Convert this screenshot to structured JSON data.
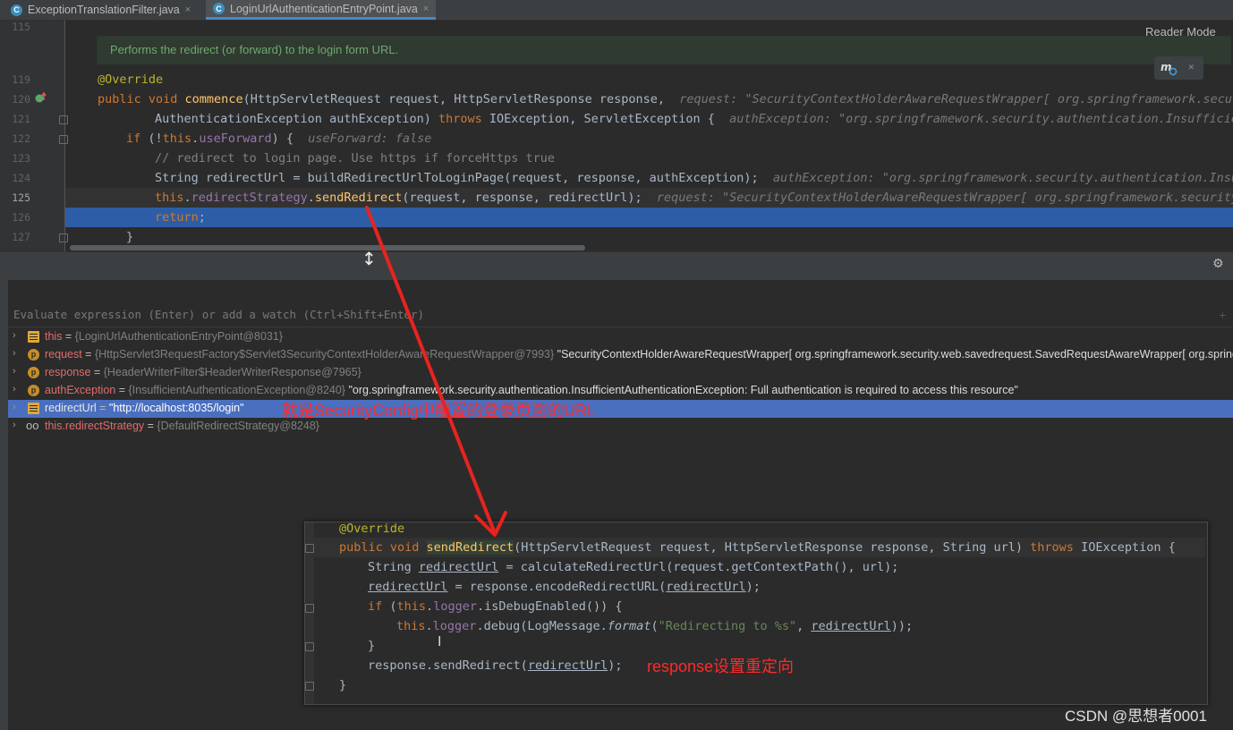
{
  "tabs": [
    {
      "label": "ExceptionTranslationFilter.java",
      "icon": "class-icon",
      "close": "×"
    },
    {
      "label": "LoginUrlAuthenticationEntryPoint.java",
      "icon": "class-icon",
      "close": "×"
    }
  ],
  "editor": {
    "reader_mode": "Reader Mode",
    "doc_comment": "Performs the redirect (or forward) to the login form URL.",
    "line_numbers": [
      "115",
      "119",
      "120",
      "121",
      "122",
      "123",
      "124",
      "125",
      "126",
      "127"
    ],
    "lines": {
      "l119": {
        "annotation": "@Override"
      },
      "l120": {
        "kw": "public void ",
        "fn": "commence",
        "rest": "(HttpServletRequest request, HttpServletResponse response, ",
        "hint": "request: \"SecurityContextHolderAwareRequestWrapper[ org.springframework.security.web.savedrequest.SavedRequestAwareWrapper"
      },
      "l121": {
        "text": "AuthenticationException authException) ",
        "kw": "throws",
        "rest": " IOException, ServletException {",
        "hint": "authException: \"org.springframework.security.authentication.InsufficientAuthenticationException"
      },
      "l122": {
        "kw": "if ",
        "pre": "(!",
        "kw2": "this",
        "dot": ".",
        "fld": "useForward",
        "post": ") {",
        "hint": "useForward: false"
      },
      "l123": {
        "comment": "// redirect to login page. Use https if forceHttps true"
      },
      "l124": {
        "text": "String redirectUrl = buildRedirectUrlToLoginPage(request, response, authException);",
        "hint": "authException: \"org.springframework.security.authentication.InsufficientAuthenticationException"
      },
      "l125": {
        "kw": "this",
        "dot": ".",
        "fld": "redirectStrategy",
        "dot2": ".",
        "call": "sendRedirect",
        "rest": "(request, response, redirectUrl);",
        "hint": "request: \"SecurityContextHolderAwareRequestWrapper[ org.springframework.security.web.savedrequest.SavedRequestAwareWrapper"
      },
      "l126": {
        "kw": "return",
        "rest": ";"
      },
      "l127": {
        "text": "}"
      }
    }
  },
  "debugger": {
    "evaluate_placeholder": "Evaluate expression (Enter) or add a watch (Ctrl+Shift+Enter)",
    "add_icon": "+",
    "variables": [
      {
        "name": "this",
        "eq": " = ",
        "type": "{LoginUrlAuthenticationEntryPoint@8031}",
        "value": "",
        "icon": "field-icon"
      },
      {
        "name": "request",
        "eq": " = ",
        "type": "{HttpServlet3RequestFactory$Servlet3SecurityContextHolderAwareRequestWrapper@7993}",
        "value": " \"SecurityContextHolderAwareRequestWrapper[ org.springframework.security.web.savedrequest.SavedRequestAwareWrapper[ org.springframework.security.web.firewall.FirewalledRequest]]\"",
        "icon": "param-icon"
      },
      {
        "name": "response",
        "eq": " = ",
        "type": "{HeaderWriterFilter$HeaderWriterResponse@7965}",
        "value": "",
        "icon": "param-icon"
      },
      {
        "name": "authException",
        "eq": " = ",
        "type": "{InsufficientAuthenticationException@8240}",
        "value": " \"org.springframework.security.authentication.InsufficientAuthenticationException: Full authentication is required to access this resource\"",
        "icon": "param-icon"
      },
      {
        "name": "redirectUrl",
        "eq": " = ",
        "type": "",
        "value": "\"http://localhost:8035/login\"",
        "icon": "field-icon"
      },
      {
        "name": "this.redirectStrategy",
        "eq": " = ",
        "type": "{DefaultRedirectStrategy@8248}",
        "value": "",
        "icon": "watch-icon"
      }
    ]
  },
  "annotations": {
    "redirect_note": "就是SecurityConfig中配置的登录页面的URL",
    "response_note": "response设置重定向"
  },
  "popup": {
    "l1": "@Override",
    "l2": {
      "kw": "public void ",
      "fn": "sendRedirect",
      "a": "(HttpServletRequest request, HttpServletResponse response, String url) ",
      "kw2": "throws",
      "b": " IOException {"
    },
    "l3": {
      "a": "String ",
      "u": "redirectUrl",
      "b": " = calculateRedirectUrl(request.getContextPath(), url);"
    },
    "l4": {
      "u": "redirectUrl",
      "b": " = response.encodeRedirectURL(",
      "u2": "redirectUrl",
      "c": ");"
    },
    "l5": {
      "kw": "if ",
      "a": "(",
      "kw2": "this",
      "b": ".",
      "fld": "logger",
      "c": ".isDebugEnabled()) {"
    },
    "l6": {
      "kw": "this",
      "a": ".",
      "fld": "logger",
      "b": ".debug(LogMessage.",
      "it": "format",
      "c": "(",
      "st": "\"Redirecting to %s\"",
      "d": ", ",
      "u": "redirectUrl",
      "e": "));"
    },
    "l7": "}",
    "l8": {
      "a": "response.sendRedirect(",
      "u": "redirectUrl",
      "b": ");"
    },
    "l9": "}"
  },
  "watermark": "CSDN @思想者0001",
  "colors": {
    "arrow": "#e8231f",
    "selection": "#2d5da6",
    "var_selection": "#4a6fbf",
    "annotation": "#ff2b2b"
  }
}
